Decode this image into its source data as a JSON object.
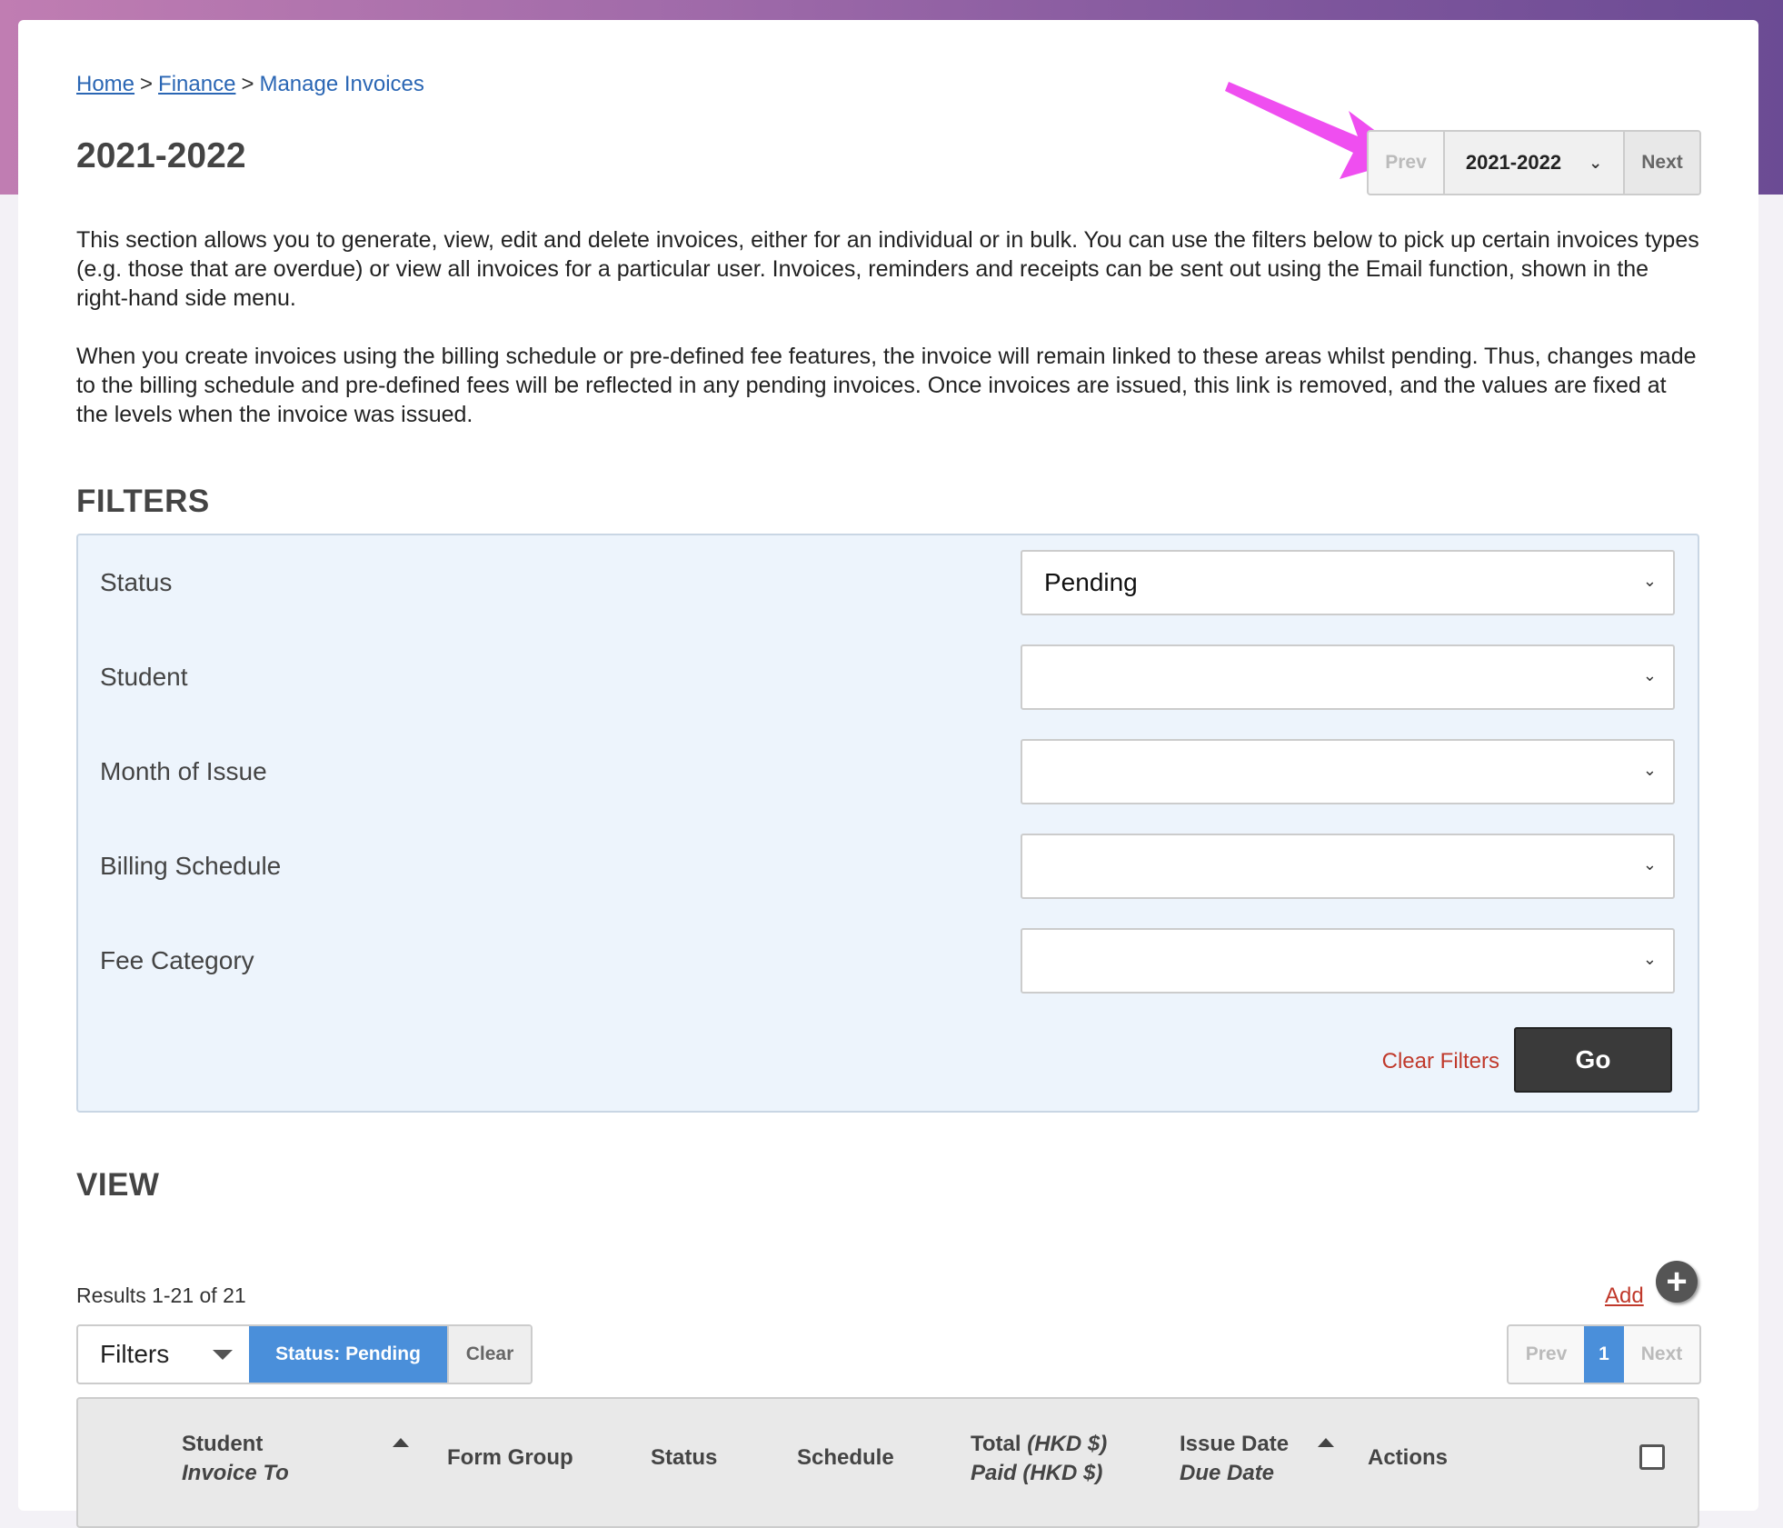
{
  "breadcrumb": {
    "home": "Home",
    "finance": "Finance",
    "current": "Manage Invoices",
    "sep": ">"
  },
  "page_title": "2021-2022",
  "year_switch": {
    "prev": "Prev",
    "selected": "2021-2022",
    "next": "Next"
  },
  "intro": {
    "p1": "This section allows you to generate, view, edit and delete invoices, either for an individual or in bulk. You can use the filters below to pick up certain invoices types (e.g. those that are overdue) or view all invoices for a particular user. Invoices, reminders and receipts can be sent out using the Email function, shown in the right-hand side menu.",
    "p2": "When you create invoices using the billing schedule or pre-defined fee features, the invoice will remain linked to these areas whilst pending. Thus, changes made to the billing schedule and pre-defined fees will be reflected in any pending invoices. Once invoices are issued, this link is removed, and the values are fixed at the levels when the invoice was issued."
  },
  "filters": {
    "heading": "FILTERS",
    "rows": [
      {
        "label": "Status",
        "value": "Pending"
      },
      {
        "label": "Student",
        "value": ""
      },
      {
        "label": "Month of Issue",
        "value": ""
      },
      {
        "label": "Billing Schedule",
        "value": ""
      },
      {
        "label": "Fee Category",
        "value": ""
      }
    ],
    "clear": "Clear Filters",
    "go": "Go"
  },
  "view": {
    "heading": "VIEW",
    "results": "Results 1-21 of 21",
    "add": "Add",
    "filter_bar": {
      "filters": "Filters",
      "status_chip": "Status: Pending",
      "clear": "Clear"
    },
    "pager": {
      "prev": "Prev",
      "current": "1",
      "next": "Next"
    },
    "columns": {
      "student": "Student",
      "invoice_to": "Invoice To",
      "form_group": "Form Group",
      "status": "Status",
      "schedule": "Schedule",
      "total": "Total",
      "total_unit": "(HKD $)",
      "paid": "Paid (HKD $)",
      "issue_date": "Issue Date",
      "due_date": "Due Date",
      "actions": "Actions"
    }
  },
  "colors": {
    "accent": "#4a8fda",
    "link": "#2a66b4",
    "danger": "#c0392b",
    "annotation_arrow": "#ef4ef0"
  }
}
